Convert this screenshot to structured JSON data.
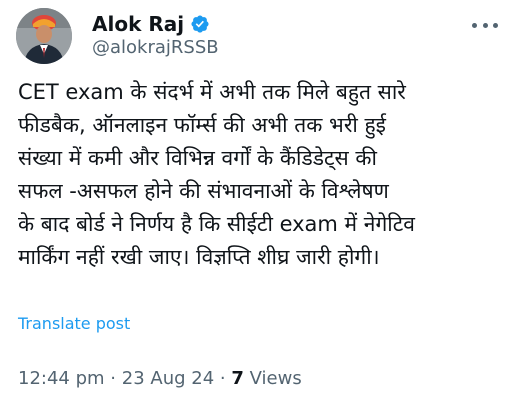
{
  "author": {
    "display_name": "Alok Raj",
    "handle": "@alokrajRSSB",
    "verified_color": "#1d9bf0"
  },
  "tweet": {
    "lines": [
      "CET exam के संदर्भ में अभी तक मिले बहुत सारे",
      "फीडबैक, ऑनलाइन फॉर्म्स की अभी तक भरी हुई",
      "संख्या में कमी और विभिन्न वर्गों के कैंडिडेट्स की",
      "सफल -असफल होने की संभावनाओं के विश्लेषण",
      "के बाद बोर्ड ने निर्णय है कि सीईटी exam में नेगेटिव",
      "मार्किंग नहीं रखी जाए। विज्ञप्ति शीघ्र जारी होगी।"
    ],
    "translate_label": "Translate post"
  },
  "meta": {
    "time": "12:44 pm",
    "separator": "·",
    "date": "23 Aug 24",
    "views_count": "7",
    "views_label": "Views"
  },
  "colors": {
    "text": "#0f1419",
    "secondary": "#536471",
    "link": "#1d9bf0"
  },
  "icons": {
    "avatar": "profile-photo",
    "verified": "verified-badge-icon",
    "more": "more-options-icon"
  }
}
